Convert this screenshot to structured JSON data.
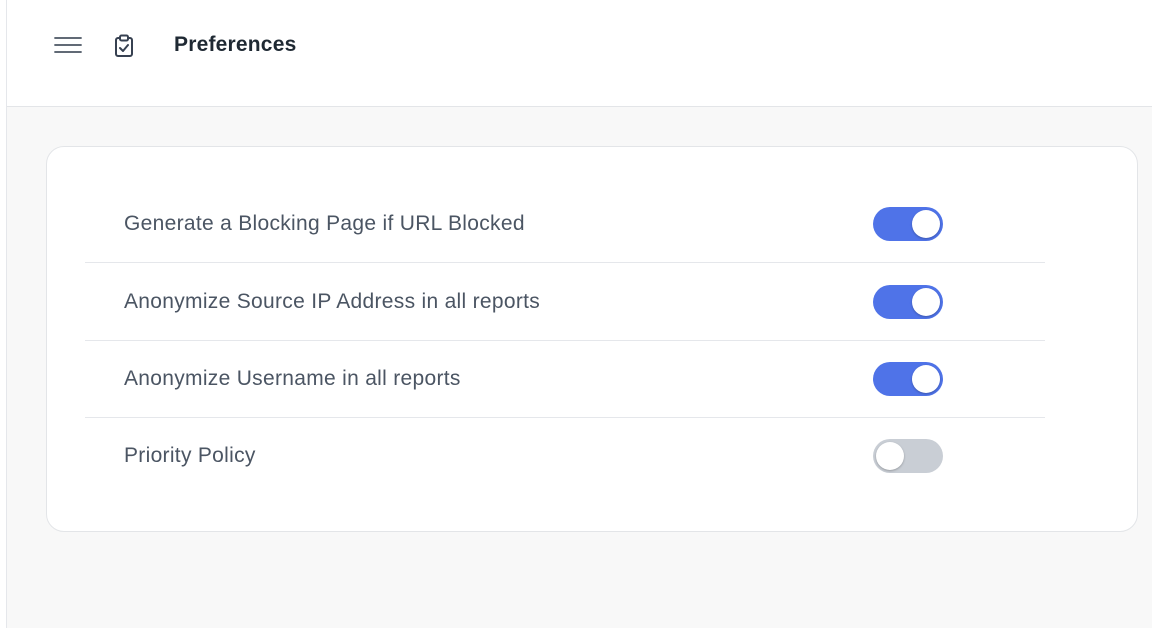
{
  "header": {
    "title": "Preferences",
    "menu_icon": "hamburger-menu-icon",
    "page_icon": "clipboard-check-icon"
  },
  "colors": {
    "accent": "#4f73e8",
    "toggle_off": "#c9ced5",
    "text": "#4b5563",
    "title": "#1f2933"
  },
  "preferences": [
    {
      "label": "Generate a Blocking Page if URL Blocked",
      "enabled": true
    },
    {
      "label": "Anonymize Source IP Address in all reports",
      "enabled": true
    },
    {
      "label": "Anonymize Username in all reports",
      "enabled": true
    },
    {
      "label": "Priority Policy",
      "enabled": false
    }
  ]
}
